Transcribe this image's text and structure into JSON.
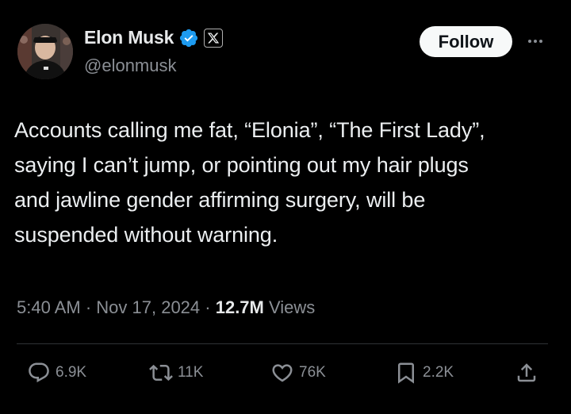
{
  "author": {
    "display_name": "Elon Musk",
    "handle": "@elonmusk",
    "verified_icon": "verified-badge-icon",
    "affiliate_icon": "x-logo-icon"
  },
  "header": {
    "follow_label": "Follow",
    "more_icon": "more-options-icon"
  },
  "tweet": {
    "line1": "Accounts calling me fat, “Elonia”, “The First Lady”,",
    "line2": "saying I can’t jump, or pointing out my hair plugs",
    "line3": "and jawline gender affirming surgery, will be",
    "line4": "suspended without warning."
  },
  "meta": {
    "time": "5:40 AM",
    "separator": " · ",
    "date": "Nov 17, 2024",
    "views_count": "12.7M",
    "views_label": " Views"
  },
  "actions": {
    "replies": "6.9K",
    "reposts": "11K",
    "likes": "76K",
    "bookmarks": "2.2K"
  },
  "colors": {
    "background": "#000000",
    "text": "#e7e9ea",
    "secondary": "#8b8f95",
    "verified": "#1d9bf0",
    "follow_bg": "#f7f9f9"
  }
}
